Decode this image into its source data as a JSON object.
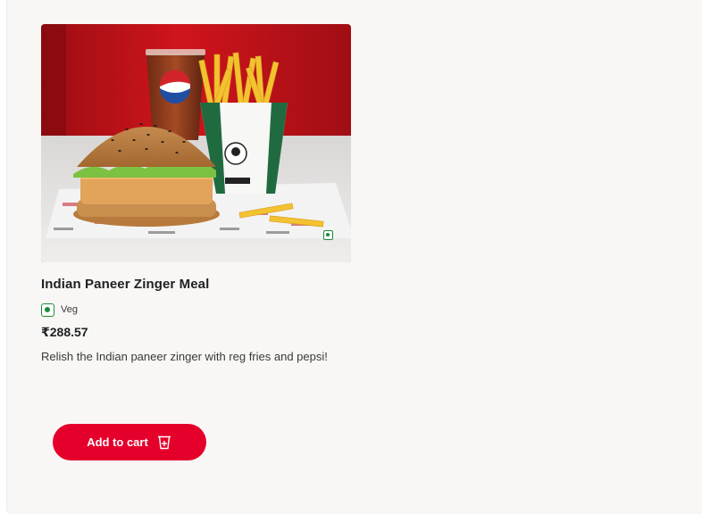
{
  "product": {
    "name": "Indian Paneer Zinger Meal",
    "diet_label": "Veg",
    "price": "₹288.57",
    "description": "Relish the Indian paneer zinger with reg fries and pepsi!",
    "image_description": "",
    "image_icon": "veg-indicator",
    "add_to_cart_label": "Add to cart",
    "cart_icon": "cart-plus-icon"
  },
  "colors": {
    "accent": "#e4002b",
    "veg_green": "#1a8c3a",
    "card_background": "#f8f7f5"
  }
}
